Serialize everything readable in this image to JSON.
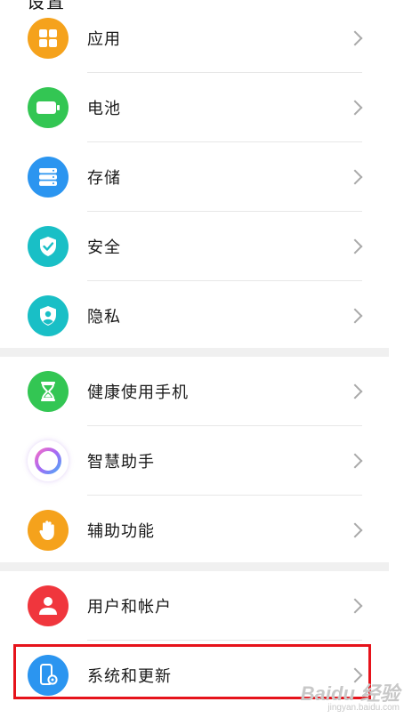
{
  "header": {
    "title": "设置"
  },
  "groups": [
    {
      "items": [
        {
          "label": "应用",
          "icon": "apps-icon",
          "color": "#f5a21c"
        },
        {
          "label": "电池",
          "icon": "battery-icon",
          "color": "#33c653"
        },
        {
          "label": "存储",
          "icon": "storage-icon",
          "color": "#2b95f0"
        },
        {
          "label": "安全",
          "icon": "shield-check-icon",
          "color": "#19bfc6"
        },
        {
          "label": "隐私",
          "icon": "privacy-shield-icon",
          "color": "#19bfc6"
        }
      ]
    },
    {
      "items": [
        {
          "label": "健康使用手机",
          "icon": "hourglass-icon",
          "color": "#33c653"
        },
        {
          "label": "智慧助手",
          "icon": "assistant-ring-icon",
          "color": "#ffffff"
        },
        {
          "label": "辅助功能",
          "icon": "hand-icon",
          "color": "#f5a21c"
        }
      ]
    },
    {
      "items": [
        {
          "label": "用户和帐户",
          "icon": "user-icon",
          "color": "#f0363d"
        },
        {
          "label": "系统和更新",
          "icon": "system-update-icon",
          "color": "#2b95f0"
        }
      ]
    }
  ],
  "annotation": {
    "highlight_color": "#e6131b"
  },
  "watermark": {
    "main": "Baidu 经验",
    "sub": "jingyan.baidu.com"
  }
}
